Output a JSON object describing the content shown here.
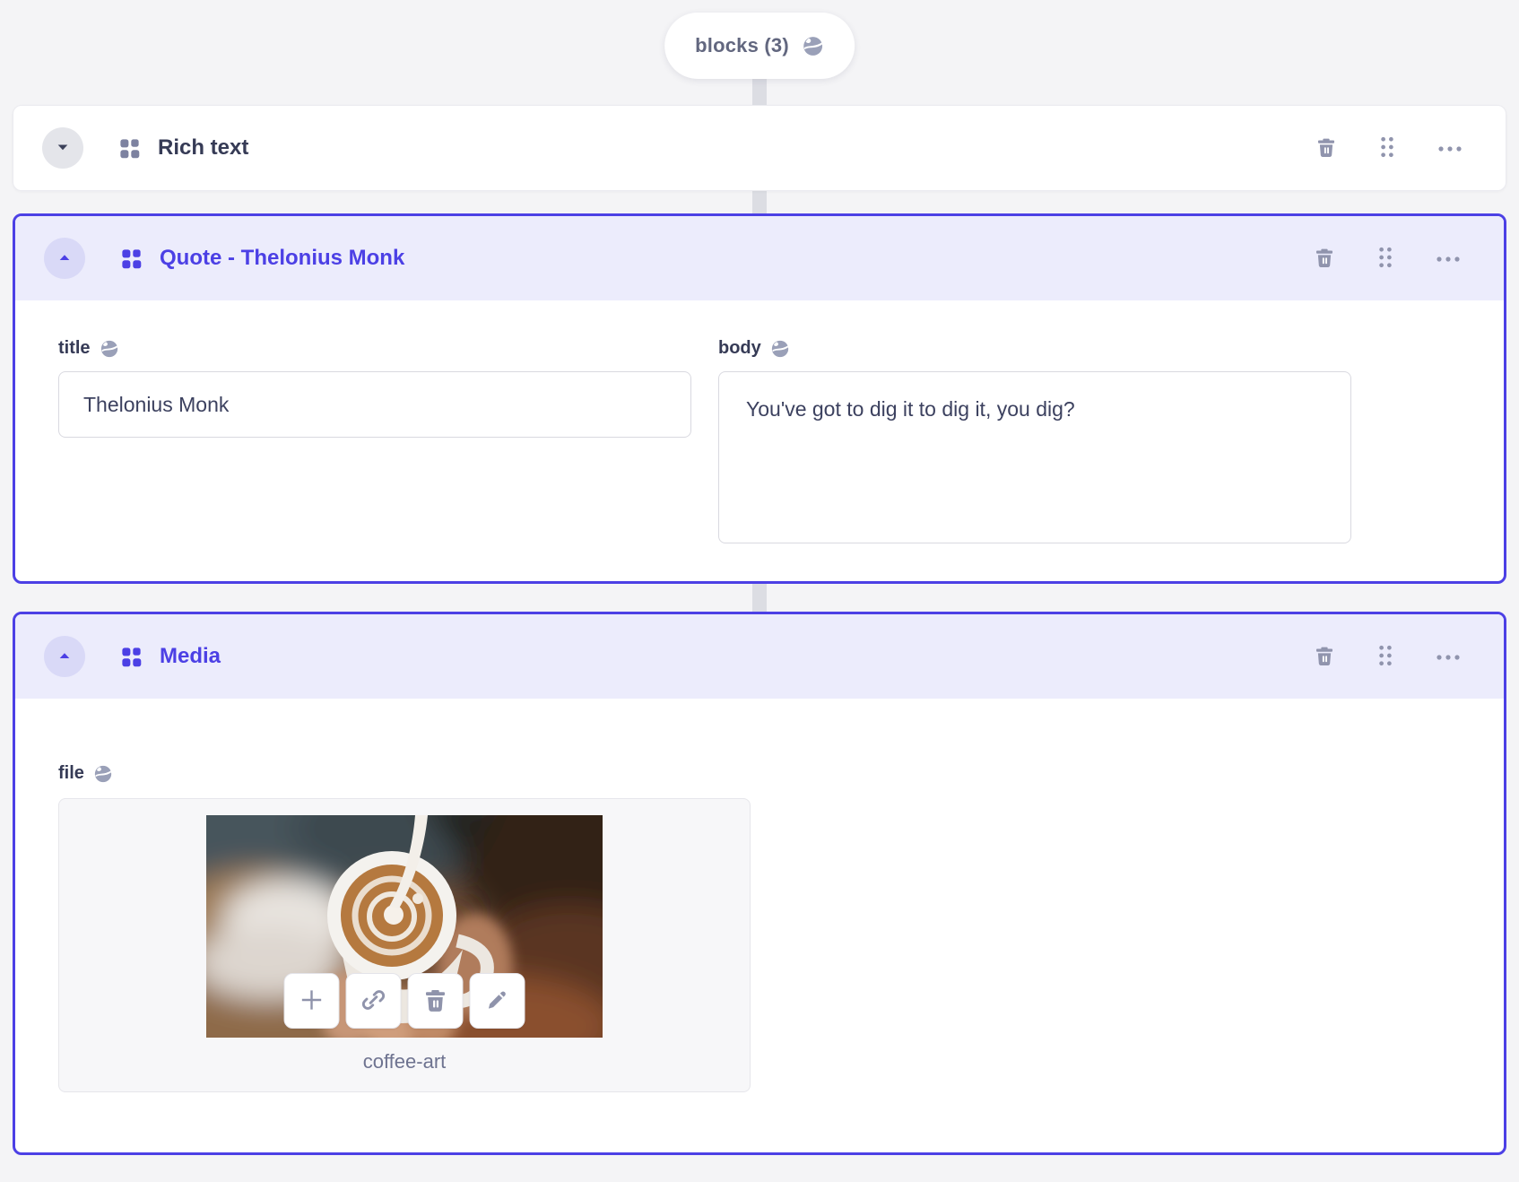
{
  "colors": {
    "accent": "#4c40e5",
    "selected_header_bg": "#ececfc",
    "page_bg": "#f4f4f6",
    "action_icon_gray": "#9094ad",
    "dark_text": "#363b56",
    "connector_gray": "#dcdde3"
  },
  "root": {
    "pill_label": "blocks (3)",
    "pill_icon": "globe-icon"
  },
  "blocks": [
    {
      "title": "Rich text",
      "state": "collapsed",
      "selected": false,
      "actions": [
        "delete",
        "drag",
        "more"
      ]
    },
    {
      "title": "Quote - Thelonius Monk",
      "state": "expanded",
      "selected": true,
      "actions": [
        "delete",
        "drag",
        "more"
      ],
      "fields": {
        "title": {
          "label": "title",
          "localized": true,
          "value": "Thelonius Monk"
        },
        "body": {
          "label": "body",
          "localized": true,
          "value": "You've got to dig it to dig it, you dig?"
        }
      }
    },
    {
      "title": "Media",
      "state": "expanded",
      "selected": true,
      "actions": [
        "delete",
        "drag",
        "more"
      ],
      "fields": {
        "file": {
          "label": "file",
          "localized": true,
          "filename": "coffee-art",
          "media_actions": [
            "add",
            "link",
            "delete",
            "edit"
          ]
        }
      }
    }
  ],
  "icons": {
    "globe-icon": "globe (localized field)",
    "blocks-icon": "2x2 grid block glyph",
    "caret-down-icon": "▾",
    "caret-up-icon": "▴",
    "trash-icon": "🗑",
    "drag-handle-icon": "⠿ (6 dots)",
    "ellipsis-icon": "⋯",
    "plus-icon": "+",
    "link-icon": "chain link",
    "pencil-icon": "✎"
  }
}
